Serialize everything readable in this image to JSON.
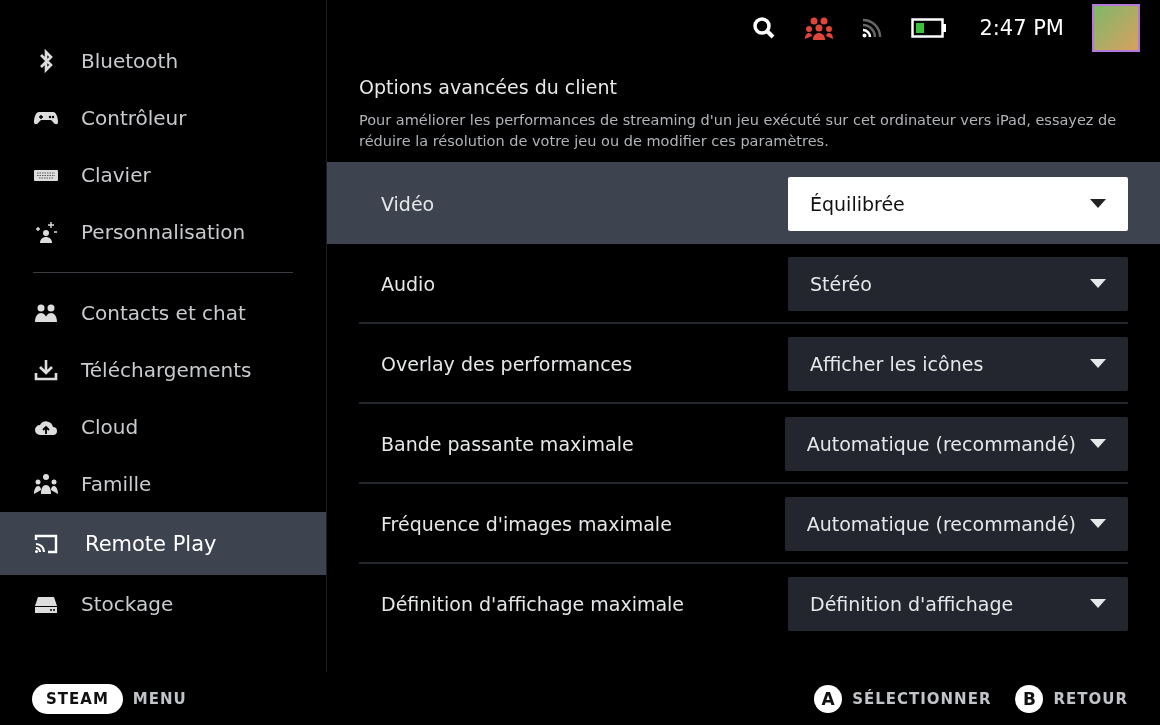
{
  "sidebar": {
    "sections": [
      {
        "items": [
          {
            "label": "Bluetooth",
            "kind": "bluetooth",
            "selected": false
          },
          {
            "label": "Contrôleur",
            "kind": "gamepad",
            "selected": false
          },
          {
            "label": "Clavier",
            "kind": "keyboard",
            "selected": false
          },
          {
            "label": "Personnalisation",
            "kind": "sparkle",
            "selected": false
          }
        ]
      },
      {
        "items": [
          {
            "label": "Contacts et chat",
            "kind": "people",
            "selected": false
          },
          {
            "label": "Téléchargements",
            "kind": "download",
            "selected": false
          },
          {
            "label": "Cloud",
            "kind": "cloud",
            "selected": false
          },
          {
            "label": "Famille",
            "kind": "family",
            "selected": false
          },
          {
            "label": "Remote Play",
            "kind": "cast",
            "selected": true
          },
          {
            "label": "Stockage",
            "kind": "drive",
            "selected": false
          }
        ]
      }
    ]
  },
  "status_bar": {
    "time": "2:47 PM"
  },
  "section": {
    "title": "Options avancées du client",
    "description": "Pour améliorer les performances de streaming d'un jeu exécuté sur cet ordinateur vers iPad, essayez de réduire la résolution de votre jeu ou de modifier ces paramètres."
  },
  "settings": [
    {
      "label": "Vidéo",
      "value": "Équilibrée",
      "selected": true
    },
    {
      "label": "Audio",
      "value": "Stéréo",
      "selected": false
    },
    {
      "label": "Overlay des performances",
      "value": "Afficher les icônes",
      "selected": false
    },
    {
      "label": "Bande passante maximale",
      "value": "Automatique (recommandé)",
      "selected": false
    },
    {
      "label": "Fréquence d'images maximale",
      "value": "Automatique (recommandé)",
      "selected": false
    },
    {
      "label": "Définition d'affichage maximale",
      "value": "Définition d'affichage",
      "selected": false
    }
  ],
  "footer": {
    "steam": "STEAM",
    "menu": "MENU",
    "hints": [
      {
        "key": "A",
        "label": "SÉLECTIONNER"
      },
      {
        "key": "B",
        "label": "RETOUR"
      }
    ]
  }
}
